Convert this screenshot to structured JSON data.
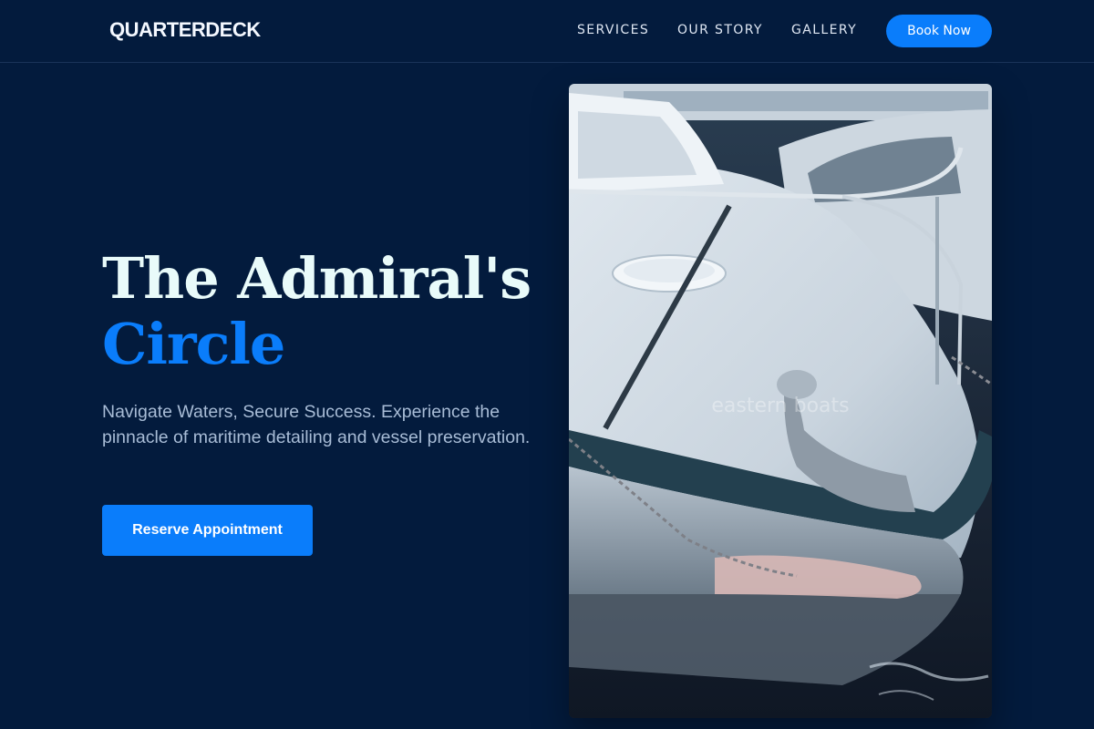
{
  "header": {
    "logo": "QUARTERDECK",
    "nav": [
      {
        "label": "SERVICES"
      },
      {
        "label": "OUR STORY"
      },
      {
        "label": "GALLERY"
      }
    ],
    "book_label": "Book Now"
  },
  "hero": {
    "title_line1": "The Admiral's",
    "title_line2": "Circle",
    "subtitle": "Navigate Waters, Secure Success. Experience the pinnacle of maritime detailing and vessel preservation.",
    "cta_label": "Reserve Appointment"
  },
  "photo": {
    "subject": "white motorboat bow at dock",
    "watermark": "eastern boats"
  },
  "colors": {
    "background": "#031b3d",
    "accent": "#0a7dfb",
    "title": "#e9fbfa",
    "subtitle": "#a8bcd6"
  }
}
